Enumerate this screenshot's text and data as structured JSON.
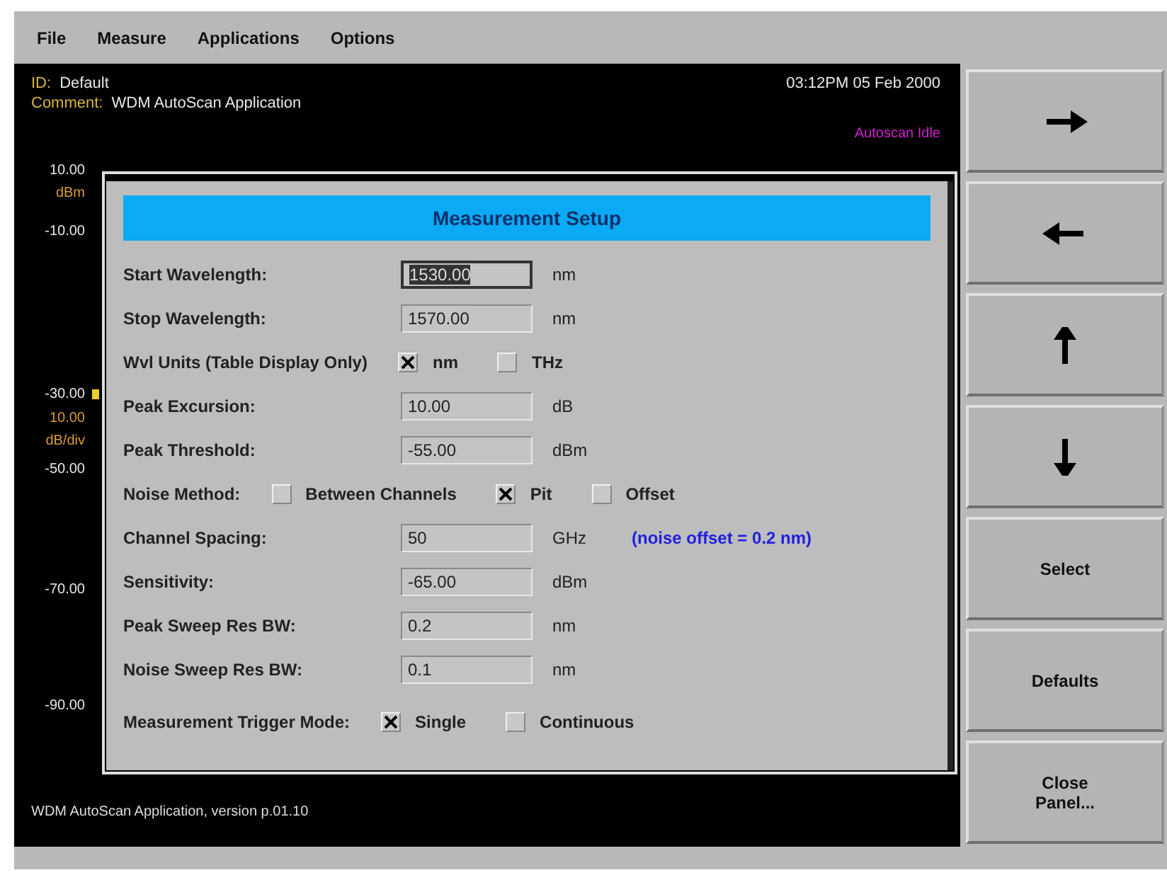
{
  "menu": [
    {
      "label": "File"
    },
    {
      "label": "Measure"
    },
    {
      "label": "Applications"
    },
    {
      "label": "Options"
    }
  ],
  "display": {
    "id_label": "ID:",
    "id_value": "Default",
    "comment_label": "Comment:",
    "comment_value": "WDM AutoScan Application",
    "datetime": "03:12PM 05 Feb 2000",
    "status": "Autoscan Idle",
    "y_axis": [
      {
        "text": "10.00",
        "kind": "tick"
      },
      {
        "text": "dBm",
        "kind": "unit"
      },
      {
        "text": "-10.00",
        "kind": "tick"
      },
      {
        "text": "-30.00",
        "kind": "tick"
      },
      {
        "text": "10.00",
        "kind": "unit"
      },
      {
        "text": "dB/div",
        "kind": "unit"
      },
      {
        "text": "-50.00",
        "kind": "tick"
      },
      {
        "text": "-70.00",
        "kind": "tick"
      },
      {
        "text": "-90.00",
        "kind": "tick"
      }
    ],
    "footer": "WDM AutoScan Application, version p.01.10"
  },
  "dialog": {
    "title": "Measurement Setup",
    "rows": [
      {
        "kind": "field",
        "label": "Start Wavelength:",
        "value": "1530.00",
        "unit": "nm",
        "focused": true
      },
      {
        "kind": "field",
        "label": "Stop Wavelength:",
        "value": "1570.00",
        "unit": "nm",
        "focused": false
      },
      {
        "kind": "options",
        "label": "Wvl Units (Table Display Only)",
        "options": [
          {
            "label": "nm",
            "checked": true
          },
          {
            "label": "THz",
            "checked": false
          }
        ]
      },
      {
        "kind": "field",
        "label": "Peak Excursion:",
        "value": "10.00",
        "unit": "dB",
        "focused": false
      },
      {
        "kind": "field",
        "label": "Peak Threshold:",
        "value": "-55.00",
        "unit": "dBm",
        "focused": false
      },
      {
        "kind": "options",
        "label": "Noise Method:",
        "options": [
          {
            "label": "Between Channels",
            "checked": false
          },
          {
            "label": "Pit",
            "checked": true
          },
          {
            "label": "Offset",
            "checked": false
          }
        ]
      },
      {
        "kind": "field",
        "label": "Channel Spacing:",
        "value": "50",
        "unit": "GHz",
        "focused": false,
        "note": "(noise offset = 0.2 nm)"
      },
      {
        "kind": "field",
        "label": "Sensitivity:",
        "value": "-65.00",
        "unit": "dBm",
        "focused": false
      },
      {
        "kind": "field",
        "label": "Peak Sweep Res BW:",
        "value": "0.2",
        "unit": "nm",
        "focused": false
      },
      {
        "kind": "field",
        "label": "Noise Sweep Res BW:",
        "value": "0.1",
        "unit": "nm",
        "focused": false
      },
      {
        "kind": "options",
        "label": "Measurement Trigger Mode:",
        "options": [
          {
            "label": "Single",
            "checked": true
          },
          {
            "label": "Continuous",
            "checked": false
          }
        ]
      }
    ]
  },
  "side_buttons": [
    {
      "kind": "right"
    },
    {
      "kind": "left"
    },
    {
      "kind": "up"
    },
    {
      "kind": "down"
    },
    {
      "kind": "text",
      "label": "Select"
    },
    {
      "kind": "text",
      "label": "Defaults"
    },
    {
      "kind": "text",
      "label": "Close Panel..."
    }
  ]
}
